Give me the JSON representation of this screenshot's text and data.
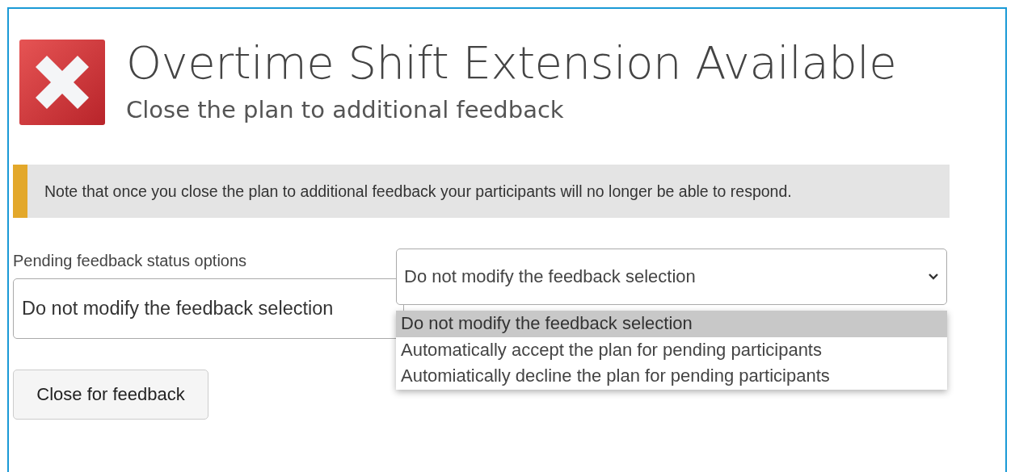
{
  "dialog": {
    "title": "Overtime Shift Extension Available",
    "subtitle": "Close the plan to additional feedback"
  },
  "note": "Note that once you close the plan to additional feedback your participants will no longer be able to respond.",
  "status_field": {
    "label": "Pending feedback status options",
    "value": "Do not modify the feedback selection"
  },
  "dropdown": {
    "value": "Do not modify the feedback selection",
    "expanded": true,
    "options": [
      {
        "label": "Do not modify the feedback selection",
        "selected": true
      },
      {
        "label": "Automatically accept the plan for pending participants",
        "selected": false
      },
      {
        "label": "Automiatically decline the plan for pending participants",
        "selected": false
      }
    ]
  },
  "button": "Close for feedback"
}
